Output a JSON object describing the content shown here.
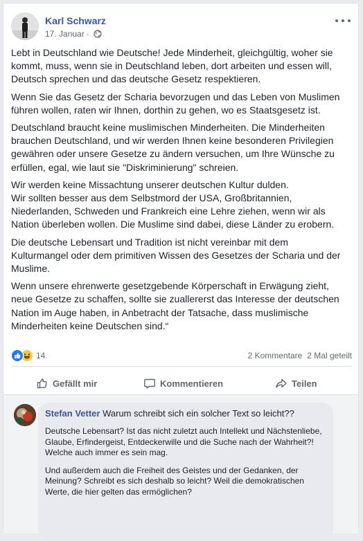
{
  "post": {
    "author": "Karl Schwarz",
    "date": "17. Januar",
    "meta_separator": "·",
    "privacy_icon": "globe-icon",
    "more_icon": "more-horizontal-icon",
    "paragraphs": [
      "Lebt in Deutschland wie Deutsche! Jede Minderheit, gleichgültig, woher sie kommt, muss, wenn sie in Deutschland leben, dort arbeiten und essen will, Deutsch sprechen und das deutsche Gesetz respektieren.",
      "Wenn Sie das Gesetz der Scharia bevorzugen und das Leben von Muslimen führen wollen, raten wir Ihnen, dorthin zu gehen, wo es Staatsgesetz ist.",
      "Deutschland braucht keine muslimischen Minderheiten. Die Minderheiten brauchen Deutschland, und wir werden Ihnen keine besonderen Privilegien gewähren oder unsere Gesetze zu ändern versuchen, um Ihre Wünsche zu erfüllen, egal, wie laut sie \"Diskriminierung\" schreien.",
      "Wir werden keine Missachtung unserer deutschen Kultur dulden.\nWir sollten besser aus dem Selbstmord der USA, Großbritannien, Niederlanden, Schweden und Frankreich eine Lehre ziehen, wenn wir als Nation überleben wollen. Die Muslime sind dabei, diese Länder zu erobern.",
      "Die deutsche Lebensart und Tradition ist nicht vereinbar mit dem Kulturmangel oder dem primitiven Wissen des Gesetzes der Scharia und der Muslime.",
      "Wenn unsere ehrenwerte gesetzgebende Körperschaft in Erwägung zieht, neue Gesetze zu schaffen, sollte sie zuallererst das Interesse der deutschen Nation im Auge haben, in Anbetracht der Tatsache, dass muslimische Minderheiten keine Deutschen sind.“"
    ],
    "reactions": {
      "icons": [
        "like-reaction-icon",
        "haha-reaction-icon"
      ],
      "count": "14",
      "comments": "2 Kommentare",
      "shares": "2 Mal geteilt"
    },
    "actions": {
      "like": "Gefällt mir",
      "comment": "Kommentieren",
      "share": "Teilen"
    }
  },
  "comment": {
    "author": "Stefan Vetter",
    "first_line": "Warum schreibt sich ein solcher Text so leicht??",
    "paragraphs": [
      "Deutsche Lebensart? Ist das nicht zuletzt auch Intellekt und Nächstenliebe, Glaube, Erfindergeist, Entdeckerwille und die Suche nach der Wahrheit?!\nWelche auch immer es sein mag.",
      "Und außerdem auch die Freiheit des Geistes und der Gedanken, der Meinung? Schreibt es sich deshalb so leicht? Weil die demokratischen Werte, die hier gelten das ermöglichen?"
    ]
  },
  "colors": {
    "page_bg": "#e9ebee",
    "link_blue": "#385898",
    "secondary_text": "#606770",
    "like_blue": "#2078f4",
    "haha_yellow": "#f7c83a",
    "comment_bubble": "#e9eaed"
  }
}
